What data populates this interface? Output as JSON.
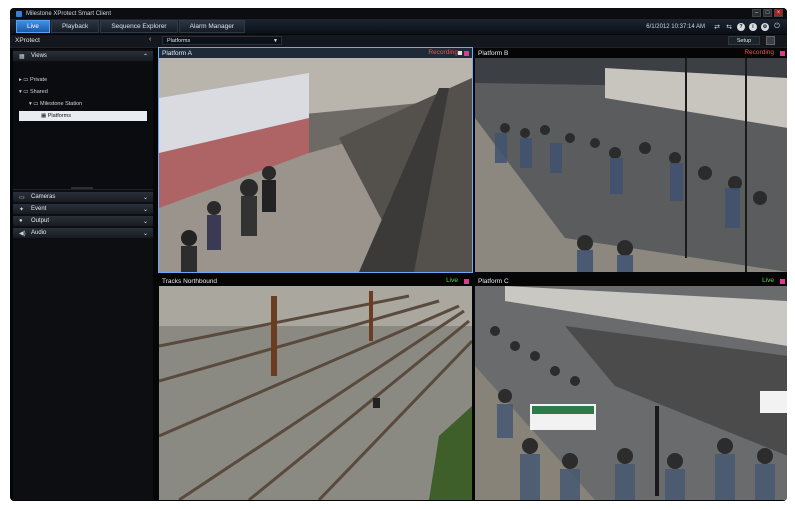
{
  "window": {
    "title": "Milestone XProtect Smart Client"
  },
  "tabs": [
    {
      "label": "Live",
      "active": true
    },
    {
      "label": "Playback",
      "active": false
    },
    {
      "label": "Sequence Explorer",
      "active": false
    },
    {
      "label": "Alarm Manager",
      "active": false
    }
  ],
  "top": {
    "datetime": "6/1/2012 10:37:14 AM",
    "icons": [
      "status-icon",
      "settings-icon",
      "help-icon",
      "user-icon",
      "logout-icon"
    ]
  },
  "header": {
    "app_name": "XProtect",
    "view_selector": "Platforms",
    "setup_label": "Setup"
  },
  "sidebar": {
    "views_label": "Views",
    "tree": [
      {
        "label": "Private"
      },
      {
        "label": "Shared"
      },
      {
        "label": "Milestone Station"
      },
      {
        "label": "Platforms",
        "selected": true
      }
    ],
    "panels": [
      "Cameras",
      "Event",
      "Output",
      "Audio"
    ]
  },
  "cameras": [
    {
      "name": "Platform A",
      "status": "Recording",
      "status_color": "#ff4d4d"
    },
    {
      "name": "Platform B",
      "status": "Recording",
      "status_color": "#ff4d4d"
    },
    {
      "name": "Tracks Northbound",
      "status": "Live",
      "status_color": "#5fd35f"
    },
    {
      "name": "Platform C",
      "status": "Live",
      "status_color": "#5fd35f"
    }
  ],
  "colors": {
    "accent": "#2a7be0",
    "recording": "#ff4d4d",
    "live": "#5fd35f",
    "marker": "#e03b8b"
  }
}
